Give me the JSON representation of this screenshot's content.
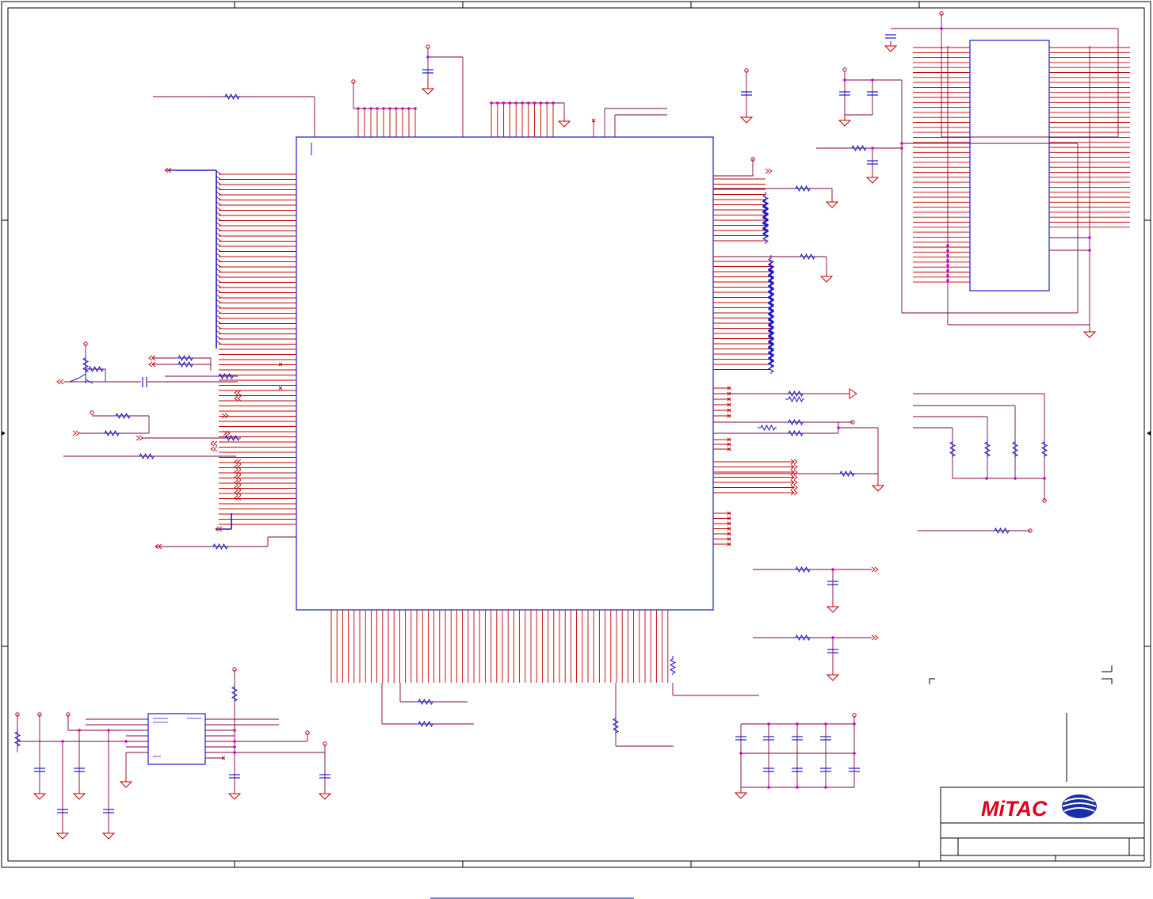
{
  "document": {
    "type": "schematic-sheet",
    "colors": {
      "border": "#000000",
      "net": "#c00000",
      "bus": "#800040",
      "component": "#1a1acc",
      "junction": "#cc00cc"
    }
  },
  "title_block": {
    "company": "MiTAC",
    "logo_icon": "mitac-globe-logo",
    "logo_colors": {
      "text": "#e0001a",
      "globe": "#1a2ea8"
    }
  },
  "footer": {
    "link_text": ""
  }
}
